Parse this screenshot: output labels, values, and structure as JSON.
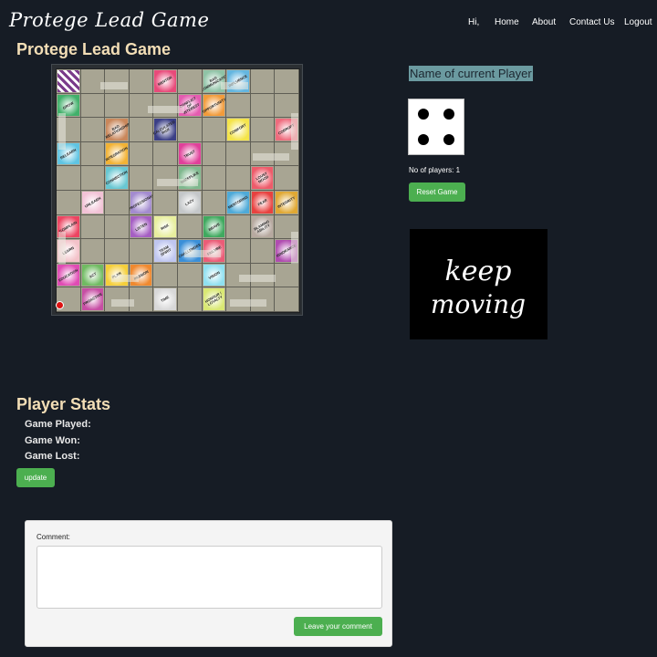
{
  "navbar": {
    "brand": "Protege Lead Game",
    "items": [
      {
        "label": "Hi,"
      },
      {
        "label": "Home"
      },
      {
        "label": "About"
      },
      {
        "label": "Contact Us"
      },
      {
        "label": "Logout"
      }
    ]
  },
  "game": {
    "title": "Protege Lead Game",
    "current_player_label": "Name of current Player",
    "dice_value": 4,
    "players_text": "No of players: 1",
    "reset_label": "Reset Game",
    "motto": {
      "line1": "keep",
      "line2": "moving"
    }
  },
  "board": {
    "square_labels": [
      "MENTOR",
      "BAD COMMUNICATION",
      "INFLUENCE",
      "GROW",
      "CONFLICT OF INTEREST",
      "OPPORTUNITY",
      "BAD RELATIONSHIP",
      "CALCULATED RISK",
      "COMFORT",
      "CORRUPT",
      "RELEARN",
      "INTEGRATION",
      "TRUST",
      "CONNECTION",
      "SHEEPLIKE",
      "LOUSY MOOD",
      "UNLEARN",
      "PROFESSIONAL",
      "LAZY",
      "MENTORING",
      "FEAR",
      "INTEGRITY",
      "COMPLAIN",
      "LISTEN",
      "RISK",
      "BRAVE",
      "BLAMING ABILITY",
      "LEARN",
      "TEAM SPIRIT",
      "CHALLENGES",
      "FAILURE",
      "IGNORANCE",
      "EDUCATION",
      "ACT",
      "PLAN",
      "PASSION",
      "VISION",
      "PROACTIVE",
      "TIME",
      "HONOUR / LOYALTY"
    ]
  },
  "stats": {
    "title": "Player Stats",
    "played_label": "Game Played:",
    "won_label": "Game Won:",
    "lost_label": "Game Lost:",
    "update_label": "update"
  },
  "comment": {
    "label": "Comment:",
    "value": "",
    "submit_label": "Leave your comment"
  },
  "colors": {
    "background": "#161c25",
    "heading": "#f3deb6",
    "button": "#4caf50",
    "player_highlight": "#6b9aa0",
    "token": "#d11111"
  }
}
